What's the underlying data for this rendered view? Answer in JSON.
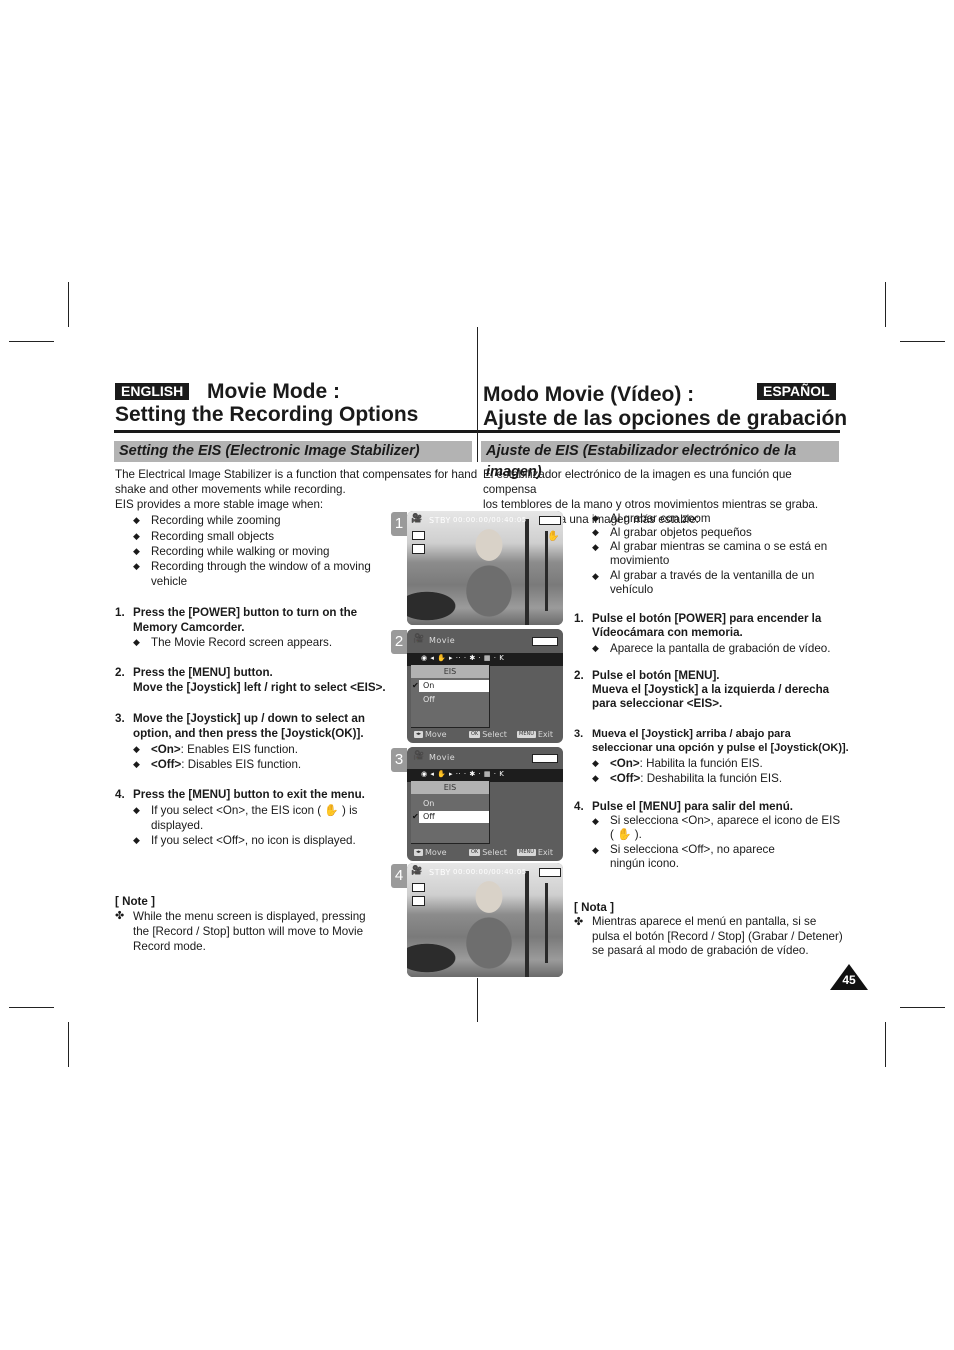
{
  "english": {
    "lang_label": "ENGLISH",
    "title_line1": "Movie Mode :",
    "title_line2": "Setting the Recording Options",
    "section_heading": "Setting the EIS (Electronic Image Stabilizer)",
    "intro_line1": "The Electrical Image Stabilizer is a function that compensates for hand",
    "intro_line2": "shake and other movements while recording.",
    "intro_line3": "EIS provides a more stable image when:",
    "conditions": [
      "Recording while zooming",
      "Recording small objects",
      "Recording while walking or moving",
      "Recording through the  window of a moving vehicle"
    ],
    "steps": [
      {
        "num": "1.",
        "text": "Press the [POWER] button to turn on the Memory Camcorder.",
        "bullets": [
          "The Movie Record screen appears."
        ]
      },
      {
        "num": "2.",
        "text_line1": "Press the [MENU] button.",
        "text_line2": "Move the [Joystick] left / right to select <EIS>."
      },
      {
        "num": "3.",
        "text": "Move the [Joystick] up / down to select an option, and then press the [Joystick(OK)].",
        "options": [
          {
            "key": "<On>",
            "desc": ": Enables EIS function."
          },
          {
            "key": "<Off>",
            "desc": ": Disables EIS function."
          }
        ]
      },
      {
        "num": "4.",
        "text": "Press the [MENU] button to exit the menu.",
        "bullets": [
          "If you select <On>, the EIS icon ( ✋ ) is displayed.",
          "If you select <Off>, no icon is displayed."
        ]
      }
    ],
    "note_heading": "[ Note ]",
    "note_text": "While the menu screen is displayed, pressing the [Record / Stop] button will move to Movie Record mode."
  },
  "spanish": {
    "lang_label": "ESPAÑOL",
    "title_line1": "Modo Movie (Vídeo) :",
    "title_line2": "Ajuste de las opciones de grabación",
    "section_heading": "Ajuste de EIS (Estabilizador electrónico de la imagen)",
    "intro_line1": "El estabilizador electrónico de la imagen es una función que compensa",
    "intro_line2": "los temblores de la mano y otros movimientos mientras se graba.",
    "intro_line3": "EIS proporciona una imagen más estable:",
    "conditions": [
      "Al grabar con zoom",
      "Al grabar objetos pequeños",
      "Al grabar mientras se camina o se está en movimiento",
      "Al grabar a través de la ventanilla de un vehículo"
    ],
    "steps": [
      {
        "num": "1.",
        "text": "Pulse el botón [POWER] para encender la Vídeocámara con memoria.",
        "bullets": [
          "Aparece la pantalla de grabación de vídeo."
        ]
      },
      {
        "num": "2.",
        "text_line1": "Pulse el botón [MENU].",
        "text_line2": "Mueva el [Joystick] a la izquierda / derecha para seleccionar <EIS>."
      },
      {
        "num": "3.",
        "text": "Mueva el [Joystick] arriba / abajo para seleccionar una opción y pulse el [Joystick(OK)].",
        "options": [
          {
            "key": "<On>",
            "desc": ": Habilita la función EIS."
          },
          {
            "key": "<Off>",
            "desc": ": Deshabilita la función EIS."
          }
        ]
      },
      {
        "num": "4.",
        "text": "Pulse el [MENU] para salir del menú.",
        "bullets": [
          "Si selecciona <On>, aparece el icono de EIS ( ✋ ).",
          "Si selecciona <Off>, no aparece ningún icono."
        ]
      }
    ],
    "note_heading": "[ Nota ]",
    "note_text": "Mientras aparece el menú en pantalla, si se pulsa el botón [Record / Stop] (Grabar / Detener) se pasará al modo de grabación de vídeo."
  },
  "screenshots": [
    {
      "num": "1",
      "status": "STBY",
      "timecode": "00:00:00/00:40:05",
      "eis_icon": true
    },
    {
      "num": "2",
      "menu_title": "Movie",
      "menu_item": "EIS",
      "options": [
        "On",
        "Off"
      ],
      "selected": "On",
      "footer": {
        "move": "Move",
        "ok_key": "OK",
        "select": "Select",
        "menu_key": "MENU",
        "exit": "Exit"
      }
    },
    {
      "num": "3",
      "menu_title": "Movie",
      "menu_item": "EIS",
      "options": [
        "On",
        "Off"
      ],
      "selected": "Off",
      "footer": {
        "move": "Move",
        "ok_key": "OK",
        "select": "Select",
        "menu_key": "MENU",
        "exit": "Exit"
      }
    },
    {
      "num": "4",
      "status": "STBY",
      "timecode": "00:00:00/00:40:05",
      "eis_icon": false
    }
  ],
  "page_number": "45"
}
